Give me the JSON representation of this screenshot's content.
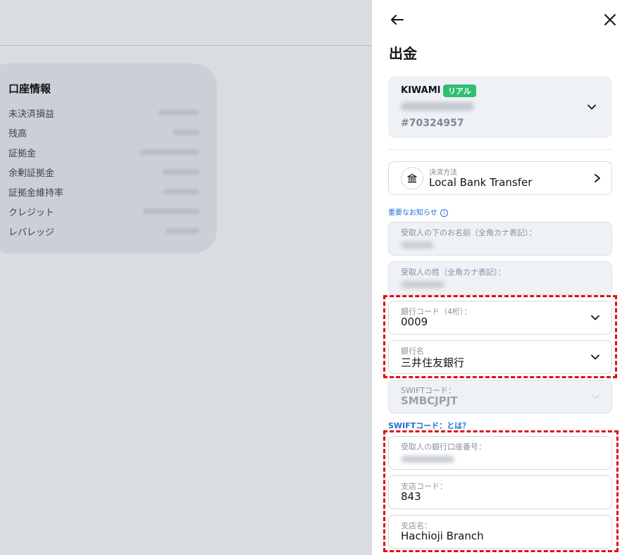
{
  "background": {
    "account_info": {
      "title": "口座情報",
      "rows": [
        {
          "label": "未決済損益"
        },
        {
          "label": "残高"
        },
        {
          "label": "証拠金"
        },
        {
          "label": "余剰証拠金"
        },
        {
          "label": "証拠金維持率"
        },
        {
          "label": "クレジット"
        },
        {
          "label": "レバレッジ"
        }
      ]
    }
  },
  "panel": {
    "title": "出金",
    "back_icon": "arrow-left-icon",
    "close_icon": "close-icon",
    "account": {
      "name": "KIWAMI",
      "badge": "リアル",
      "number": "#70324957",
      "accent": "#2fbf71"
    },
    "payment_method": {
      "label": "決済方法",
      "value": "Local Bank Transfer",
      "icon": "bank-icon"
    },
    "notice_link": "重要なお知らせ",
    "fields": {
      "first_name": {
        "label": "受取人の下のお名前（全角カナ表記）："
      },
      "last_name": {
        "label": "受取人の姓（全角カナ表記）："
      },
      "bank_code": {
        "label": "銀行コード（4桁）：",
        "value": "0009"
      },
      "bank_name": {
        "label": "銀行名",
        "value": "三井住友銀行"
      },
      "swift_code": {
        "label": "SWIFTコード：",
        "value": "SMBCJPJT"
      },
      "account_number": {
        "label": "受取人の銀行口座番号："
      },
      "branch_code": {
        "label": "支店コード：",
        "value": "843"
      },
      "branch_name": {
        "label": "支店名：",
        "value": "Hachioji Branch"
      }
    },
    "swift_link": "SWIFTコード：とは？"
  },
  "colors": {
    "link": "#1f6fd1",
    "highlight": "#e01010"
  }
}
